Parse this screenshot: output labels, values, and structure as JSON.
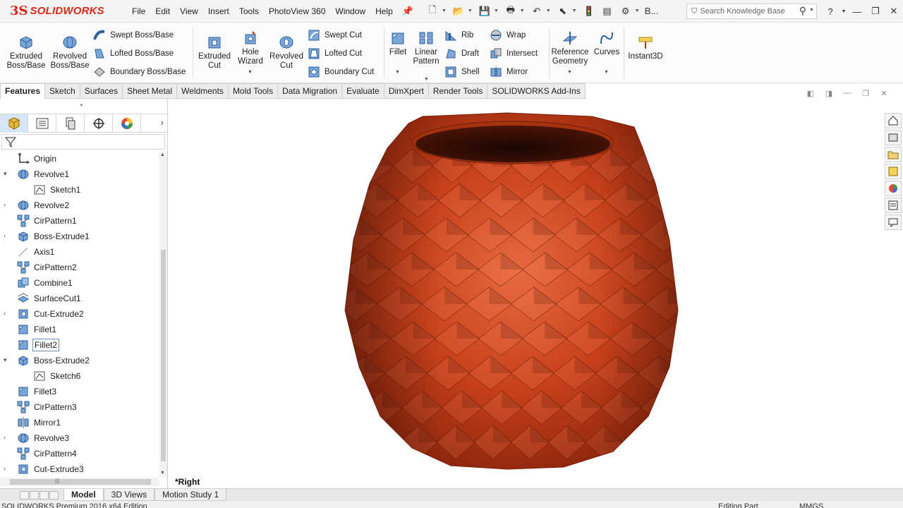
{
  "app": {
    "brand": "SOLIDWORKS",
    "brand_mark": "3S"
  },
  "menu": [
    "File",
    "Edit",
    "View",
    "Insert",
    "Tools",
    "PhotoView 360",
    "Window",
    "Help"
  ],
  "quick_access": {
    "truncated_label": "B..."
  },
  "search": {
    "placeholder": "Search Knowledge Base"
  },
  "ribbon": {
    "extruded_boss": "Extruded Boss/Base",
    "revolved_boss": "Revolved Boss/Base",
    "swept_boss": "Swept Boss/Base",
    "lofted_boss": "Lofted Boss/Base",
    "boundary_boss": "Boundary Boss/Base",
    "extruded_cut": "Extruded Cut",
    "hole_wizard": "Hole Wizard",
    "revolved_cut": "Revolved Cut",
    "swept_cut": "Swept Cut",
    "lofted_cut": "Lofted Cut",
    "boundary_cut": "Boundary Cut",
    "fillet": "Fillet",
    "linear_pattern": "Linear Pattern",
    "rib": "Rib",
    "draft": "Draft",
    "shell": "Shell",
    "wrap": "Wrap",
    "intersect": "Intersect",
    "mirror": "Mirror",
    "reference_geometry": "Reference Geometry",
    "curves": "Curves",
    "instant3d": "Instant3D"
  },
  "command_tabs": [
    "Features",
    "Sketch",
    "Surfaces",
    "Sheet Metal",
    "Weldments",
    "Mold Tools",
    "Data Migration",
    "Evaluate",
    "DimXpert",
    "Render Tools",
    "SOLIDWORKS Add-Ins"
  ],
  "active_tab": "Features",
  "feature_tree": [
    {
      "label": "Origin",
      "icon": "origin-icon",
      "indent": 0,
      "expand": ""
    },
    {
      "label": "Revolve1",
      "icon": "revolve-icon",
      "indent": 0,
      "expand": "▾"
    },
    {
      "label": "Sketch1",
      "icon": "sketch-icon",
      "indent": 1,
      "expand": ""
    },
    {
      "label": "Revolve2",
      "icon": "revolve-icon",
      "indent": 0,
      "expand": "›"
    },
    {
      "label": "CirPattern1",
      "icon": "circular-pattern-icon",
      "indent": 0,
      "expand": ""
    },
    {
      "label": "Boss-Extrude1",
      "icon": "extrude-icon",
      "indent": 0,
      "expand": "›"
    },
    {
      "label": "Axis1",
      "icon": "axis-icon",
      "indent": 0,
      "expand": ""
    },
    {
      "label": "CirPattern2",
      "icon": "circular-pattern-icon",
      "indent": 0,
      "expand": ""
    },
    {
      "label": "Combine1",
      "icon": "combine-icon",
      "indent": 0,
      "expand": ""
    },
    {
      "label": "SurfaceCut1",
      "icon": "surface-cut-icon",
      "indent": 0,
      "expand": ""
    },
    {
      "label": "Cut-Extrude2",
      "icon": "cut-extrude-icon",
      "indent": 0,
      "expand": "›"
    },
    {
      "label": "Fillet1",
      "icon": "fillet-icon",
      "indent": 0,
      "expand": ""
    },
    {
      "label": "Fillet2",
      "icon": "fillet-icon",
      "indent": 0,
      "expand": "",
      "selected": true
    },
    {
      "label": "Boss-Extrude2",
      "icon": "extrude-icon",
      "indent": 0,
      "expand": "▾"
    },
    {
      "label": "Sketch6",
      "icon": "sketch-icon",
      "indent": 1,
      "expand": ""
    },
    {
      "label": "Fillet3",
      "icon": "fillet-icon",
      "indent": 0,
      "expand": ""
    },
    {
      "label": "CirPattern3",
      "icon": "circular-pattern-icon",
      "indent": 0,
      "expand": ""
    },
    {
      "label": "Mirror1",
      "icon": "mirror-icon",
      "indent": 0,
      "expand": ""
    },
    {
      "label": "Revolve3",
      "icon": "revolve-icon",
      "indent": 0,
      "expand": "›"
    },
    {
      "label": "CirPattern4",
      "icon": "circular-pattern-icon",
      "indent": 0,
      "expand": ""
    },
    {
      "label": "Cut-Extrude3",
      "icon": "cut-extrude-icon",
      "indent": 0,
      "expand": "›"
    }
  ],
  "viewport": {
    "view_name": "*Right",
    "model_color": "#c7401a"
  },
  "bottom_tabs": [
    "Model",
    "3D Views",
    "Motion Study 1"
  ],
  "active_bottom_tab": "Model",
  "status": {
    "left": "SOLIDWORKS Premium 2016 x64 Edition",
    "mode": "Editing Part",
    "units": "MMGS"
  },
  "colors": {
    "brand": "#d9261c",
    "accent": "#3a6fc4",
    "selection": "#d7e6f7"
  }
}
